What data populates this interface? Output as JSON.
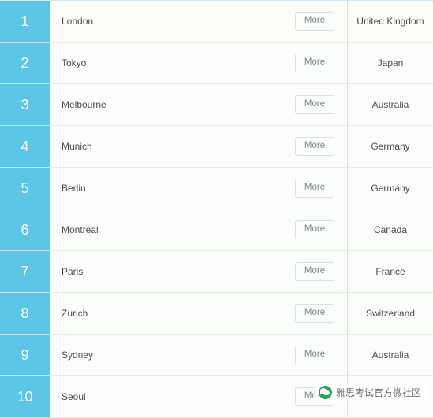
{
  "table": {
    "more_label": "More",
    "rows": [
      {
        "rank": "1",
        "city": "London",
        "country": "United Kingdom"
      },
      {
        "rank": "2",
        "city": "Tokyo",
        "country": "Japan"
      },
      {
        "rank": "3",
        "city": "Melbourne",
        "country": "Australia"
      },
      {
        "rank": "4",
        "city": "Munich",
        "country": "Germany"
      },
      {
        "rank": "5",
        "city": "Berlin",
        "country": "Germany"
      },
      {
        "rank": "6",
        "city": "Montreal",
        "country": "Canada"
      },
      {
        "rank": "7",
        "city": "Paris",
        "country": "France"
      },
      {
        "rank": "8",
        "city": "Zurich",
        "country": "Switzerland"
      },
      {
        "rank": "9",
        "city": "Sydney",
        "country": "Australia"
      },
      {
        "rank": "10",
        "city": "Seoul",
        "country": ""
      }
    ]
  },
  "watermark": {
    "text": "雅思考试官方微社区"
  },
  "colors": {
    "rank_bg": "#5bc6e8",
    "row_bg": "#fbfdfb",
    "text": "#4c4c4c"
  }
}
